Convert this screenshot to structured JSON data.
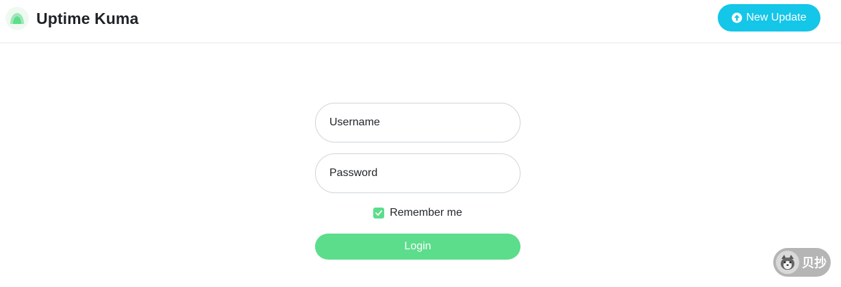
{
  "header": {
    "app_title": "Uptime Kuma",
    "logo_icon": "uptime-kuma-logo-icon",
    "new_update_label": "New Update",
    "new_update_icon": "arrow-up-circle-icon"
  },
  "login_form": {
    "username": {
      "placeholder": "Username",
      "value": ""
    },
    "password": {
      "placeholder": "Password",
      "value": ""
    },
    "remember_me": {
      "label": "Remember me",
      "checked": true
    },
    "login_label": "Login"
  },
  "watermark": {
    "text": "贝抄",
    "icon": "husky-face-icon"
  },
  "colors": {
    "accent_green": "#5cdd8b",
    "update_button": "#14c6e8",
    "border": "#ced4da"
  }
}
